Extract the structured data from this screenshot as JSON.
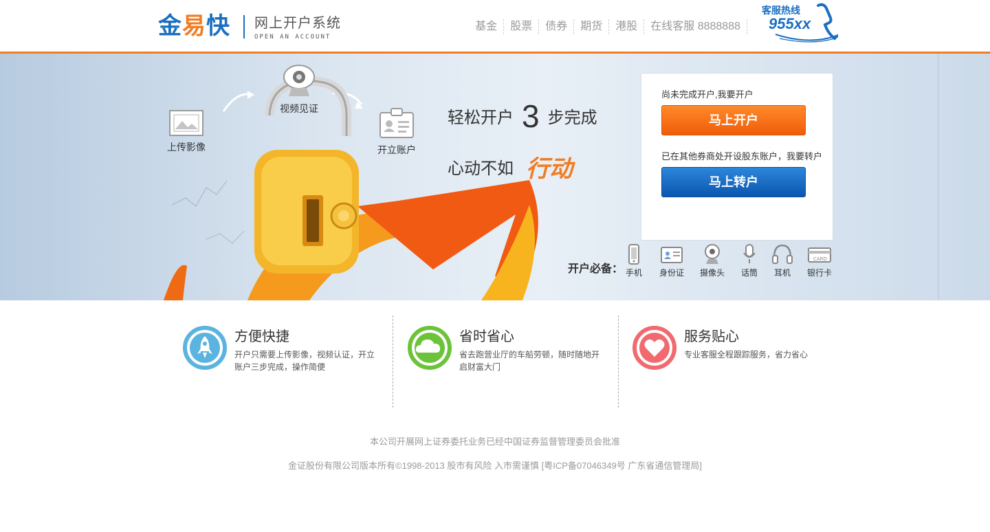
{
  "header": {
    "logo": {
      "c1": "金",
      "c2": "易",
      "c3": "快"
    },
    "subtitle_cn": "网上开户系统",
    "subtitle_en": "OPEN AN ACCOUNT",
    "nav": [
      "基金",
      "股票",
      "债券",
      "期货",
      "港股",
      "在线客服 8888888"
    ],
    "hotline_label": "客服热线",
    "hotline_number": "955xx"
  },
  "banner": {
    "steps": [
      "上传影像",
      "视频见证",
      "开立账户"
    ],
    "slogan_line1_pre": "轻松开户",
    "slogan_big": "3",
    "slogan_line1_post": "步完成",
    "slogan_line2": "心动不如",
    "slogan_action": "行动",
    "panel": {
      "hint_open": "尚未完成开户,我要开户",
      "open_button": "马上开户",
      "hint_transfer": "已在其他券商处开设股东账户，我要转户",
      "transfer_button": "马上转户"
    },
    "needs_label": "开户必备：",
    "needs": [
      "手机",
      "身份证",
      "摄像头",
      "话筒",
      "耳机",
      "银行卡"
    ],
    "card_text": "CARD"
  },
  "features": [
    {
      "title": "方便快捷",
      "desc": "开户只需要上传影像，视频认证，开立账户三步完成，操作简便",
      "color": "#5ab4df"
    },
    {
      "title": "省时省心",
      "desc": "省去跑营业厅的车船劳顿，随时随地开启财富大门",
      "color": "#6cc33a"
    },
    {
      "title": "服务贴心",
      "desc": "专业客服全程跟踪服务，省力省心",
      "color": "#f06a6f"
    }
  ],
  "footer": {
    "line1": "本公司开展网上证券委托业务已经中国证券监督管理委员会批准",
    "line2": "金证股份有限公司版本所有©1998-2013  股市有风险 入市需谨慎  [粤ICP备07046349号 广东省通信管理局]"
  },
  "colors": {
    "accent": "#f07d24",
    "brand": "#1b6fc1",
    "open_button": "#f26a14",
    "transfer_button": "#0d5db5"
  }
}
